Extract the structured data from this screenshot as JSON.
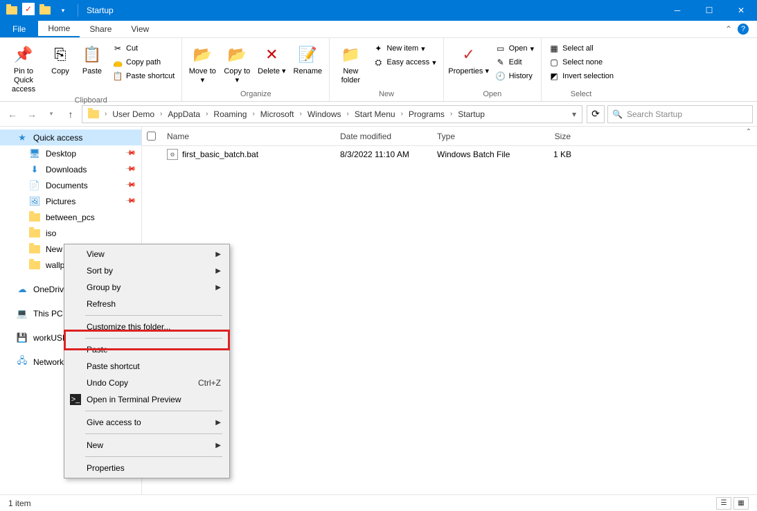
{
  "window": {
    "title": "Startup"
  },
  "menutabs": {
    "file": "File",
    "home": "Home",
    "share": "Share",
    "view": "View"
  },
  "ribbon": {
    "clipboard": {
      "label": "Clipboard",
      "pin": "Pin to Quick access",
      "copy": "Copy",
      "paste": "Paste",
      "cut": "Cut",
      "copypath": "Copy path",
      "pasteshortcut": "Paste shortcut"
    },
    "organize": {
      "label": "Organize",
      "moveto": "Move to",
      "copyto": "Copy to",
      "delete": "Delete",
      "rename": "Rename"
    },
    "new": {
      "label": "New",
      "newfolder": "New folder",
      "newitem": "New item",
      "easyaccess": "Easy access"
    },
    "open": {
      "label": "Open",
      "properties": "Properties",
      "open": "Open",
      "edit": "Edit",
      "history": "History"
    },
    "select": {
      "label": "Select",
      "selectall": "Select all",
      "selectnone": "Select none",
      "invert": "Invert selection"
    }
  },
  "breadcrumbs": [
    "User Demo",
    "AppData",
    "Roaming",
    "Microsoft",
    "Windows",
    "Start Menu",
    "Programs",
    "Startup"
  ],
  "search": {
    "placeholder": "Search Startup"
  },
  "columns": {
    "name": "Name",
    "date": "Date modified",
    "type": "Type",
    "size": "Size"
  },
  "files": [
    {
      "name": "first_basic_batch.bat",
      "date": "8/3/2022 11:10 AM",
      "type": "Windows Batch File",
      "size": "1 KB"
    }
  ],
  "nav": {
    "quick": "Quick access",
    "desktop": "Desktop",
    "downloads": "Downloads",
    "documents": "Documents",
    "pictures": "Pictures",
    "between": "between_pcs",
    "iso": "iso",
    "newvo": "New Vo",
    "wallpap": "wallpap",
    "onedrive": "OneDriv",
    "thispc": "This PC",
    "workusb": "workUSB",
    "network": "Network"
  },
  "context": {
    "view": "View",
    "sortby": "Sort by",
    "groupby": "Group by",
    "refresh": "Refresh",
    "customize": "Customize this folder...",
    "paste": "Paste",
    "pasteshortcut": "Paste shortcut",
    "undocopy": "Undo Copy",
    "undocopy_sc": "Ctrl+Z",
    "terminal": "Open in Terminal Preview",
    "giveaccess": "Give access to",
    "new": "New",
    "properties": "Properties"
  },
  "status": {
    "count": "1 item"
  }
}
